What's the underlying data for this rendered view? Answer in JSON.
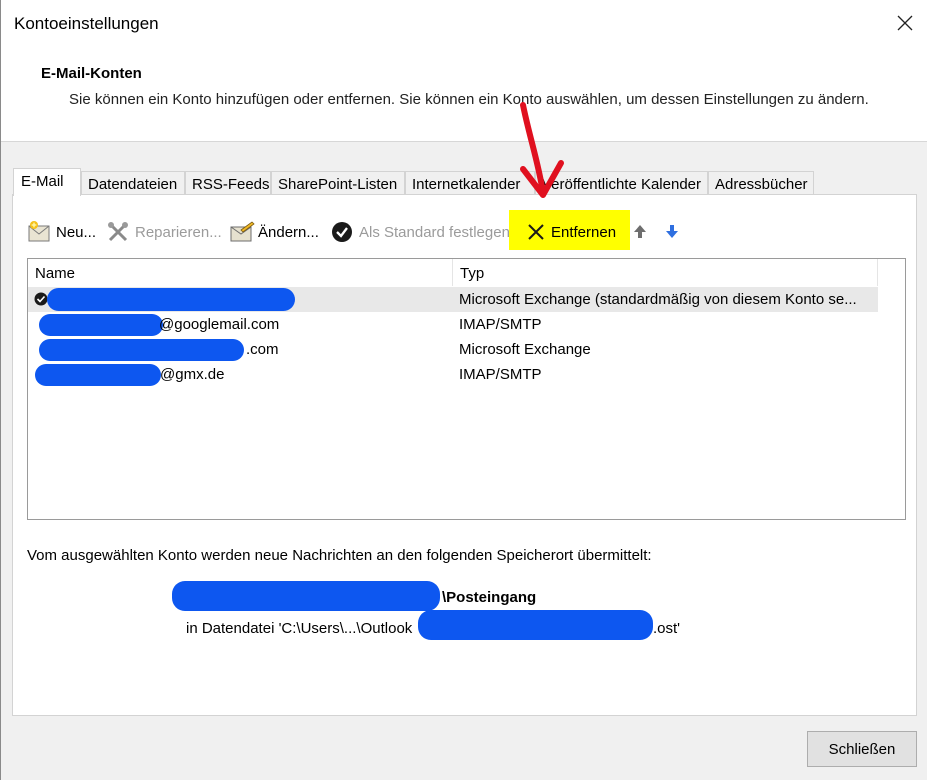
{
  "window": {
    "title": "Kontoeinstellungen"
  },
  "header": {
    "title": "E-Mail-Konten",
    "description": "Sie können ein Konto hinzufügen oder entfernen. Sie können ein Konto auswählen, um dessen Einstellungen zu ändern."
  },
  "tabs": [
    {
      "label": "E-Mail"
    },
    {
      "label": "Datendateien"
    },
    {
      "label": "RSS-Feeds"
    },
    {
      "label": "SharePoint-Listen"
    },
    {
      "label": "Internetkalender"
    },
    {
      "label": "Veröffentlichte Kalender"
    },
    {
      "label": "Adressbücher"
    }
  ],
  "toolbar": {
    "new_label": "Neu...",
    "repair_label": "Reparieren...",
    "change_label": "Ändern...",
    "default_label": "Als Standard festlegen",
    "remove_label": "Entfernen"
  },
  "accounts": {
    "columns": {
      "name": "Name",
      "type": "Typ"
    },
    "rows": [
      {
        "name": "",
        "type": "Microsoft Exchange (standardmäßig von diesem Konto se..."
      },
      {
        "name": "@googlemail.com",
        "type": "IMAP/SMTP"
      },
      {
        "name": ".com",
        "type": "Microsoft Exchange"
      },
      {
        "name": "@gmx.de",
        "type": "IMAP/SMTP"
      }
    ]
  },
  "delivery": {
    "text": "Vom ausgewählten Konto werden neue Nachrichten an den folgenden Speicherort übermittelt:",
    "folder": "\\Posteingang",
    "datafile_prefix": "in Datendatei 'C:\\Users\\...\\Outlook",
    "datafile_suffix": ".ost'"
  },
  "footer": {
    "close_label": "Schließen"
  },
  "colors": {
    "highlight": "#ffff00",
    "redaction": "#0d57f0",
    "annotation_arrow": "#e0101f"
  }
}
